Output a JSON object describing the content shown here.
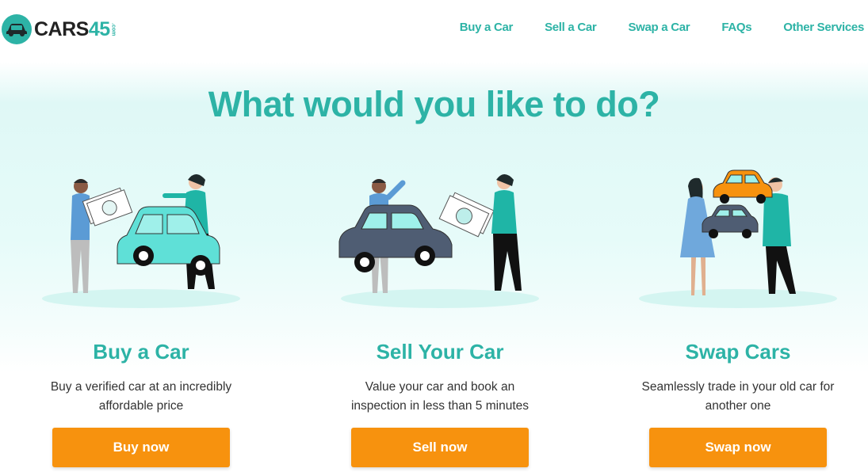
{
  "brand": {
    "name_part1": "CARS",
    "name_part2": "45",
    "suffix": ".com",
    "accent": "#2db3a6",
    "cta": "#f7920e"
  },
  "nav": [
    {
      "label": "Buy a Car"
    },
    {
      "label": "Sell a Car"
    },
    {
      "label": "Swap a Car"
    },
    {
      "label": "FAQs"
    },
    {
      "label": "Other Services"
    }
  ],
  "hero": {
    "title": "What would you like to do?"
  },
  "cards": [
    {
      "title": "Buy a Car",
      "desc_line1": "Buy a verified car at an incredibly",
      "desc_line2": "affordable price",
      "button": "Buy now",
      "illustration": "buy-car-illustration"
    },
    {
      "title": "Sell Your Car",
      "desc_line1": "Value your car and book an",
      "desc_line2": "inspection in less than 5 minutes",
      "button": "Sell now",
      "illustration": "sell-car-illustration"
    },
    {
      "title": "Swap Cars",
      "desc_line1": "Seamlessly trade in your old car for",
      "desc_line2": "another one",
      "button": "Swap now",
      "illustration": "swap-car-illustration"
    }
  ]
}
